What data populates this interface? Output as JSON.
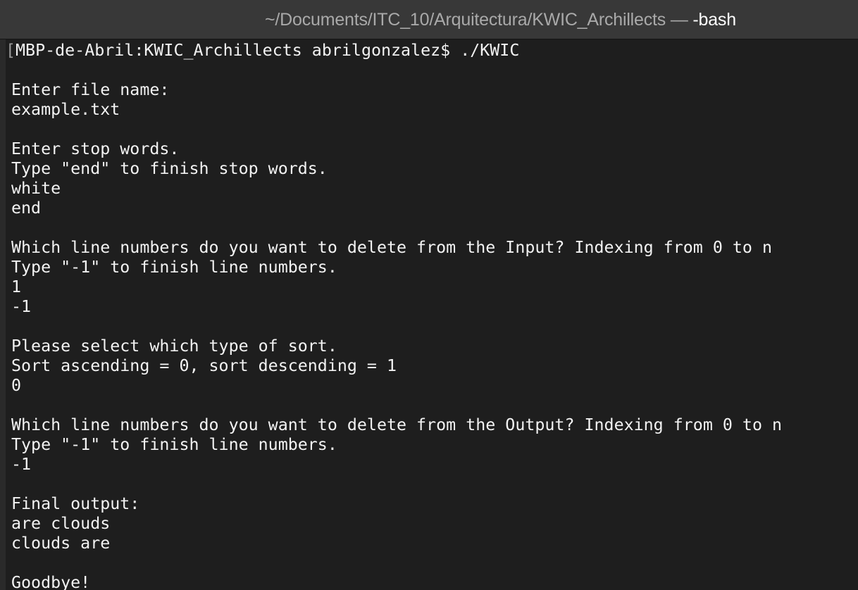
{
  "window": {
    "title_path": "~/Documents/ITC_10/Arquitectura/KWIC_Archillects",
    "title_separator": " — ",
    "title_process": "-bash"
  },
  "terminal": {
    "prompt_bracket": "[",
    "prompt": "MBP-de-Abril:KWIC_Archillects abrilgonzalez$ ./KWIC",
    "lines": [
      "",
      "Enter file name:",
      "example.txt",
      "",
      "Enter stop words.",
      "Type \"end\" to finish stop words.",
      "white",
      "end",
      "",
      "Which line numbers do you want to delete from the Input? Indexing from 0 to n",
      "Type \"-1\" to finish line numbers.",
      "1",
      "-1",
      "",
      "Please select which type of sort.",
      "Sort ascending = 0, sort descending = 1",
      "0",
      "",
      "Which line numbers do you want to delete from the Output? Indexing from 0 to n",
      "Type \"-1\" to finish line numbers.",
      "-1",
      "",
      "Final output:",
      "are clouds",
      "clouds are",
      "",
      "Goodbye!"
    ]
  }
}
